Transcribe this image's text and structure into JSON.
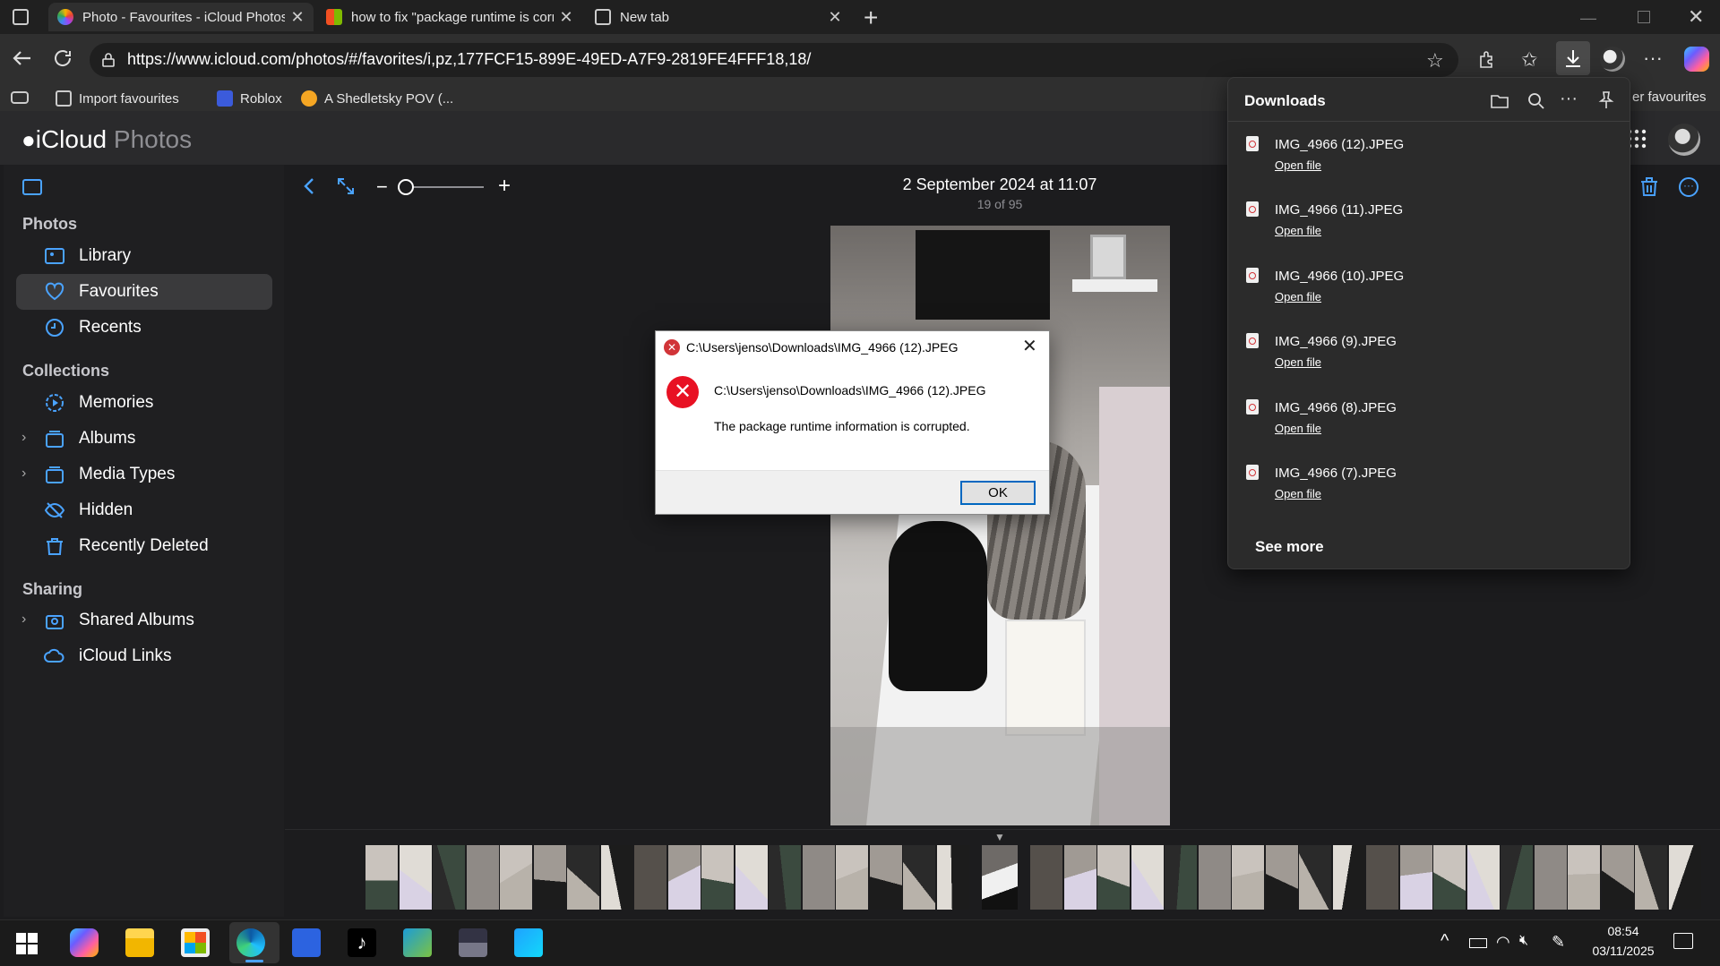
{
  "browser": {
    "tabs": [
      {
        "title": "Photo - Favourites - iCloud Photos",
        "active": true
      },
      {
        "title": "how to fix \"package runtime is corrupted\"",
        "active": false
      },
      {
        "title": "New tab",
        "active": false
      }
    ],
    "url": "https://www.icloud.com/photos/#/favorites/i,pz,177FCF15-899E-49ED-A7F9-2819FE4FFF18,18/",
    "bookmarks": [
      "Import favourites",
      "Roblox",
      "A Shedletsky POV (..."
    ],
    "other_favourites_fragment": "er favourites"
  },
  "app": {
    "logo_icloud": "iCloud",
    "logo_photos": "Photos"
  },
  "sidebar": {
    "sections": [
      {
        "title": "Photos",
        "items": [
          "Library",
          "Favourites",
          "Recents"
        ]
      },
      {
        "title": "Collections",
        "items": [
          "Memories",
          "Albums",
          "Media Types",
          "Hidden",
          "Recently Deleted"
        ]
      },
      {
        "title": "Sharing",
        "items": [
          "Shared Albums",
          "iCloud Links"
        ]
      }
    ]
  },
  "viewer": {
    "date": "2 September 2024 at 11:07",
    "position": "19 of 95"
  },
  "downloads": {
    "title": "Downloads",
    "items": [
      {
        "name": "IMG_4966 (12).JPEG",
        "action": "Open file"
      },
      {
        "name": "IMG_4966 (11).JPEG",
        "action": "Open file"
      },
      {
        "name": "IMG_4966 (10).JPEG",
        "action": "Open file"
      },
      {
        "name": "IMG_4966 (9).JPEG",
        "action": "Open file"
      },
      {
        "name": "IMG_4966 (8).JPEG",
        "action": "Open file"
      },
      {
        "name": "IMG_4966 (7).JPEG",
        "action": "Open file"
      }
    ],
    "see_more": "See more"
  },
  "dialog": {
    "title": "C:\\Users\\jenso\\Downloads\\IMG_4966 (12).JPEG",
    "path": "C:\\Users\\jenso\\Downloads\\IMG_4966 (12).JPEG",
    "message": "The package runtime information is corrupted.",
    "ok": "OK"
  },
  "taskbar": {
    "time": "08:54",
    "date": "03/11/2025"
  }
}
